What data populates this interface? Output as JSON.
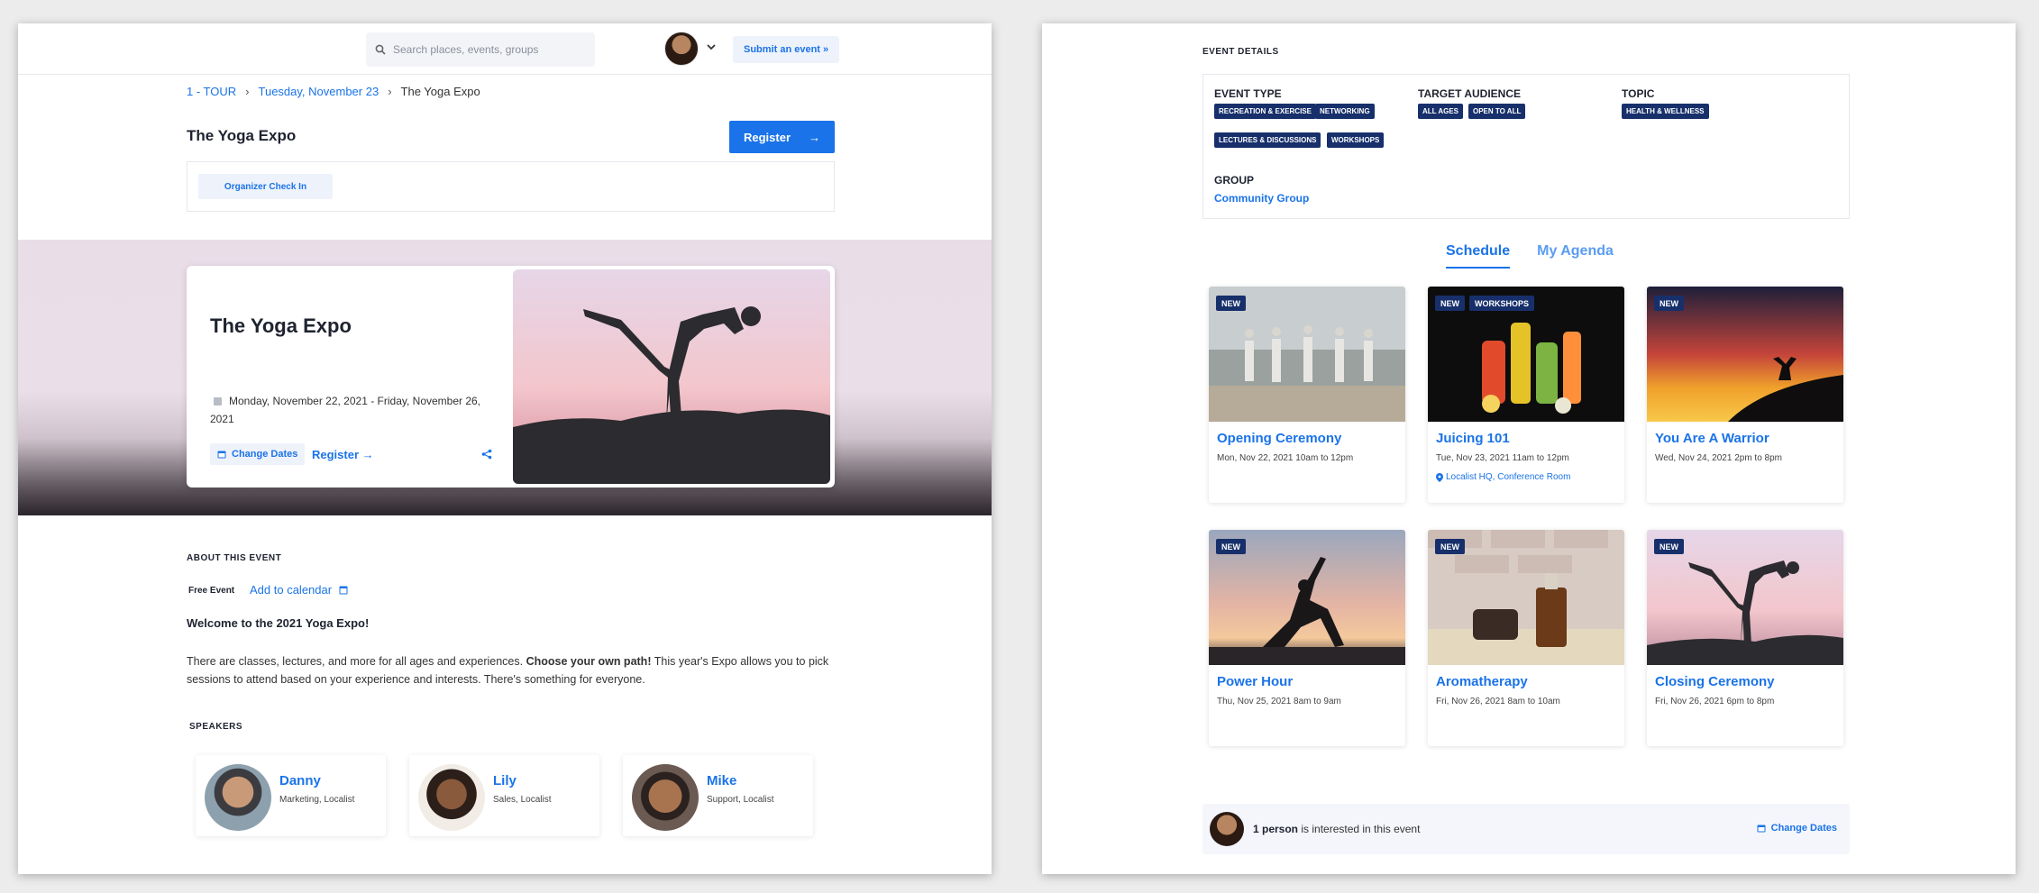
{
  "left": {
    "search": {
      "placeholder": "Search places, events, groups"
    },
    "header": {
      "submit_label": "Submit an event »"
    },
    "breadcrumb": [
      "1 - TOUR",
      "Tuesday, November 23",
      "The Yoga Expo"
    ],
    "title": "The Yoga Expo",
    "register_label": "Register",
    "organizer_checkin": "Organizer Check In",
    "hero": {
      "title": "The Yoga Expo",
      "date": "Monday, November 22, 2021 - Friday, November 26, 2021",
      "change_dates": "Change Dates",
      "register": "Register →"
    },
    "about": {
      "heading": "ABOUT THIS EVENT",
      "free_event": "Free Event",
      "add_calendar": "Add to calendar",
      "welcome": "Welcome to the 2021 Yoga Expo!",
      "desc_pre": "There are classes, lectures, and more for all ages and experiences. ",
      "desc_bold": "Choose your own path!",
      "desc_post": " This year's Expo allows you to pick sessions to attend based on your experience and interests. There's something for everyone."
    },
    "speakers": {
      "heading": "SPEAKERS",
      "items": [
        {
          "name": "Danny",
          "role": "Marketing, Localist"
        },
        {
          "name": "Lily",
          "role": "Sales, Localist"
        },
        {
          "name": "Mike",
          "role": "Support, Localist"
        }
      ]
    }
  },
  "right": {
    "details_heading": "EVENT DETAILS",
    "event_type": {
      "label": "EVENT TYPE",
      "tags": [
        "RECREATION & EXERCISE",
        "NETWORKING",
        "LECTURES & DISCUSSIONS",
        "WORKSHOPS"
      ]
    },
    "target_audience": {
      "label": "TARGET AUDIENCE",
      "tags": [
        "ALL AGES",
        "OPEN TO ALL"
      ]
    },
    "topic": {
      "label": "TOPIC",
      "tags": [
        "HEALTH & WELLNESS"
      ]
    },
    "group": {
      "label": "GROUP",
      "value": "Community Group"
    },
    "tabs": [
      "Schedule",
      "My Agenda"
    ],
    "cards": [
      {
        "badges": [
          "NEW"
        ],
        "title": "Opening Ceremony",
        "time": "Mon, Nov 22, 2021 10am to 12pm"
      },
      {
        "badges": [
          "NEW",
          "WORKSHOPS"
        ],
        "title": "Juicing 101",
        "time": "Tue, Nov 23, 2021 11am to 12pm",
        "location": "Localist HQ, Conference Room"
      },
      {
        "badges": [
          "NEW"
        ],
        "title": "You Are A Warrior",
        "time": "Wed, Nov 24, 2021 2pm to 8pm"
      },
      {
        "badges": [
          "NEW"
        ],
        "title": "Power Hour",
        "time": "Thu, Nov 25, 2021 8am to 9am"
      },
      {
        "badges": [
          "NEW"
        ],
        "title": "Aromatherapy",
        "time": "Fri, Nov 26, 2021 8am to 10am"
      },
      {
        "badges": [
          "NEW"
        ],
        "title": "Closing Ceremony",
        "time": "Fri, Nov 26, 2021 6pm to 8pm"
      }
    ],
    "footer": {
      "count": "1 person",
      "text": " is interested in this event",
      "change_dates": "Change Dates"
    }
  },
  "colors": {
    "accent": "#1a73e8",
    "tag_bg": "#17306b"
  }
}
